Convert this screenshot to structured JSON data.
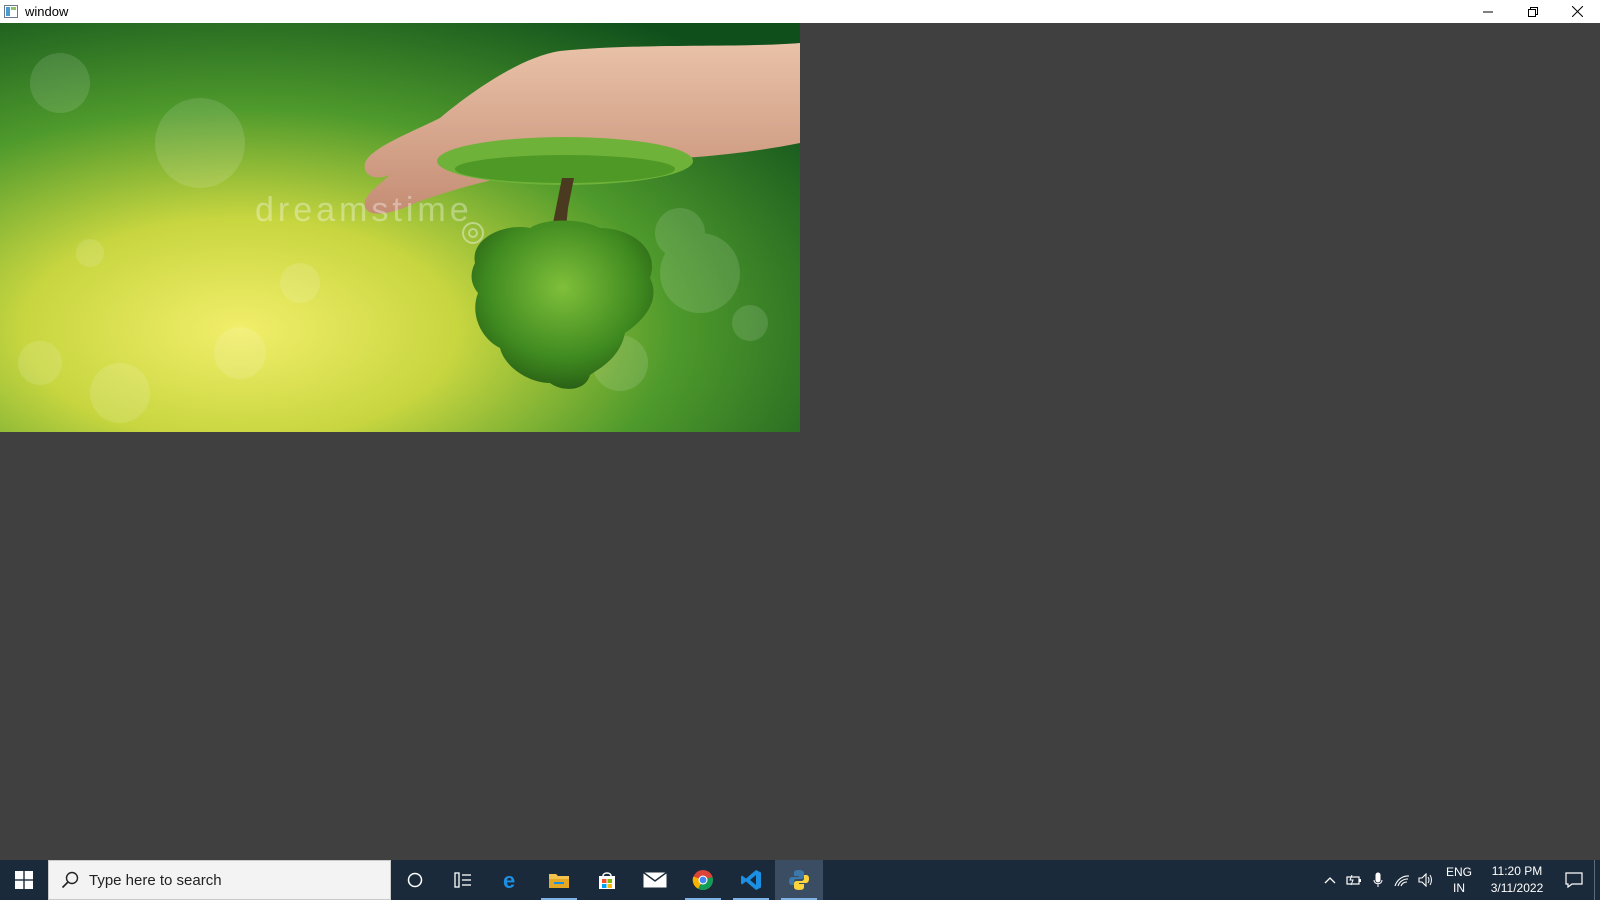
{
  "window": {
    "title": "window",
    "controls": [
      "minimize",
      "restore",
      "close"
    ]
  },
  "image": {
    "description_icons": "hand-holding-tree-photo",
    "watermark": "dreamstime"
  },
  "taskbar": {
    "search_placeholder": "Type here to search",
    "pinned": [
      "cortana-icon",
      "task-view-icon",
      "edge-icon",
      "file-explorer-icon",
      "store-icon",
      "mail-icon",
      "chrome-icon",
      "vscode-icon",
      "python-icon"
    ],
    "tray": {
      "lang_line1": "ENG",
      "lang_line2": "IN",
      "time": "11:20 PM",
      "date": "3/11/2022"
    }
  },
  "colors": {
    "background": "#404040",
    "taskbar": "#1b2a3a",
    "accent": "#0078d7"
  }
}
